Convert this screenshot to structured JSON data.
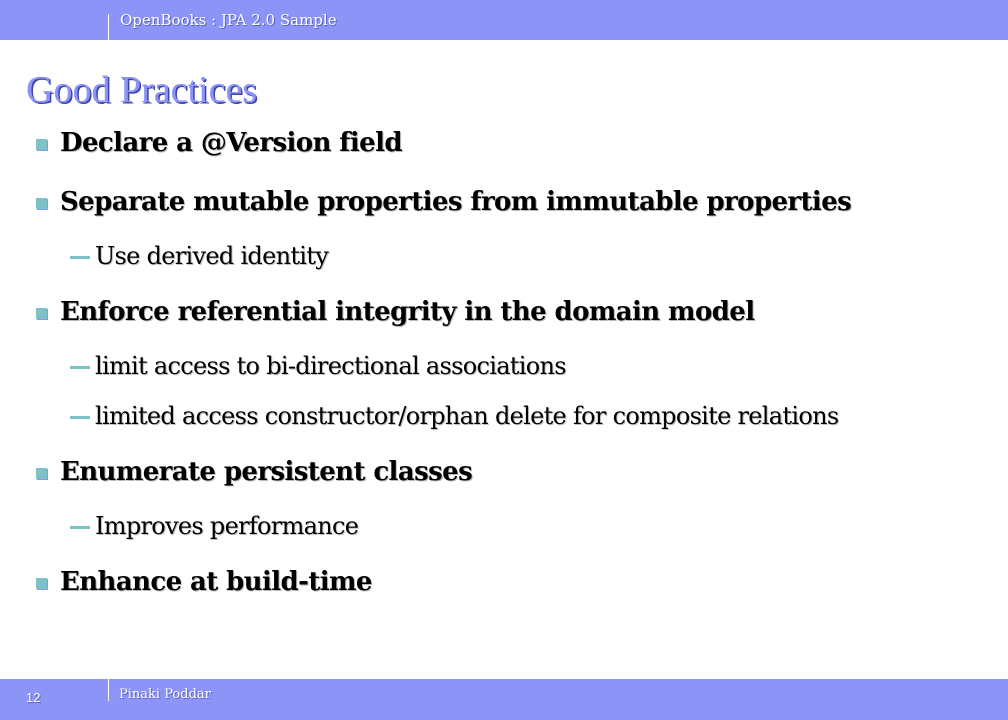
{
  "header": {
    "title": "OpenBooks : JPA 2.0 Sample"
  },
  "slide": {
    "title": "Good Practices",
    "bullets": [
      {
        "level": 1,
        "text": "Declare a @Version field"
      },
      {
        "level": 1,
        "text": "Separate mutable properties from immutable properties"
      },
      {
        "level": 2,
        "text": "Use derived identity"
      },
      {
        "level": 1,
        "text": "Enforce referential integrity in the domain model"
      },
      {
        "level": 2,
        "text": "limit access to bi-directional associations"
      },
      {
        "level": 2,
        "text": "limited access constructor/orphan delete for composite relations"
      },
      {
        "level": 1,
        "text": "Enumerate persistent classes"
      },
      {
        "level": 2,
        "text": "Improves performance"
      },
      {
        "level": 1,
        "text": "Enhance at build-time"
      }
    ]
  },
  "footer": {
    "page_number": "12",
    "author": "Pinaki Poddar"
  },
  "colors": {
    "bar": "#8c95f7",
    "title": "#8c95f7",
    "marker": "#7ec2c8",
    "text": "#000000"
  }
}
